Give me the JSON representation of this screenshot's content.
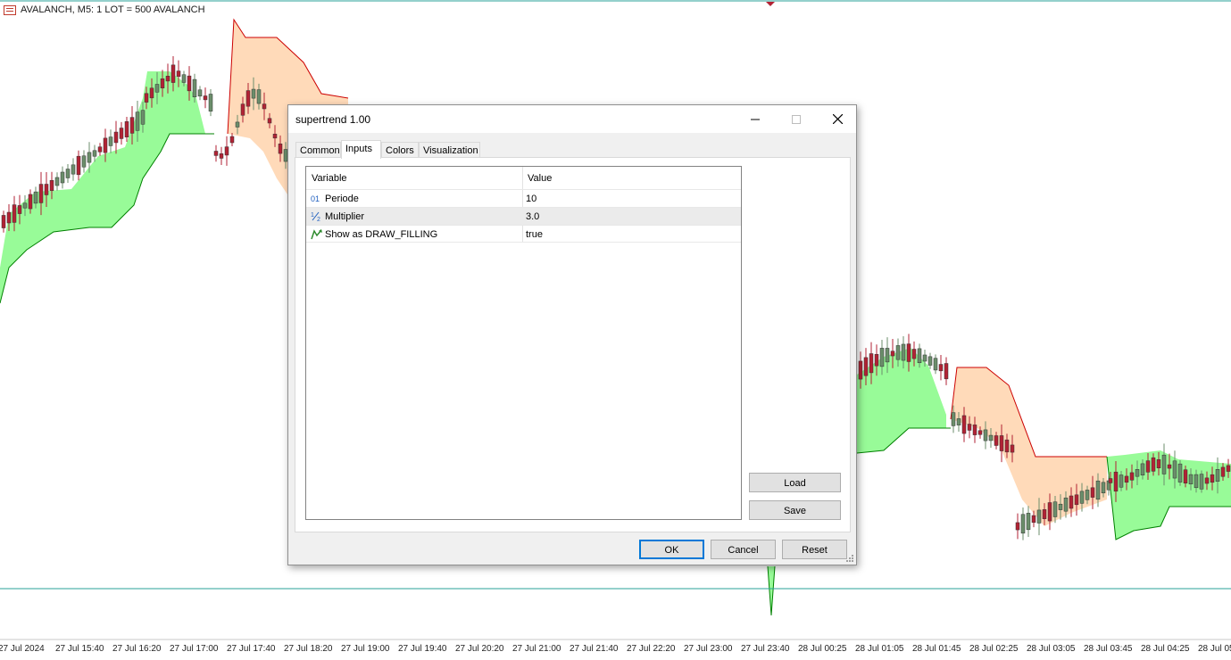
{
  "chart": {
    "title": "AVALANCH, M5:  1 LOT = 500 AVALANCH",
    "icon": "chart-window-icon",
    "time_labels": [
      "27 Jul 2024",
      "27 Jul 15:40",
      "27 Jul 16:20",
      "27 Jul 17:00",
      "27 Jul 17:40",
      "27 Jul 18:20",
      "27 Jul 19:00",
      "27 Jul 19:40",
      "27 Jul 20:20",
      "27 Jul 21:00",
      "27 Jul 21:40",
      "27 Jul 22:20",
      "27 Jul 23:00",
      "27 Jul 23:40",
      "28 Jul 00:25",
      "28 Jul 01:05",
      "28 Jul 01:45",
      "28 Jul 02:25",
      "28 Jul 03:05",
      "28 Jul 03:45",
      "28 Jul 04:25",
      "28 Jul 05"
    ],
    "colors": {
      "bull_fill": "#98fb98",
      "bear_fill": "#ffdab9",
      "bear_line": "#cc0000",
      "bull_line": "#008000",
      "candle_up": "#6b8e6b",
      "candle_down": "#b22234",
      "hline": "#2aa198"
    }
  },
  "dialog": {
    "title": "supertrend 1.00",
    "tabs": [
      "Common",
      "Inputs",
      "Colors",
      "Visualization"
    ],
    "active_tab": "Inputs",
    "table": {
      "headers": [
        "Variable",
        "Value"
      ],
      "rows": [
        {
          "icon": "integer-icon",
          "name": "Periode",
          "value": "10"
        },
        {
          "icon": "double-icon",
          "name": "Multiplier",
          "value": "3.0"
        },
        {
          "icon": "bool-icon",
          "name": "Show as DRAW_FILLING",
          "value": "true"
        }
      ]
    },
    "buttons": {
      "load": "Load",
      "save": "Save",
      "ok": "OK",
      "cancel": "Cancel",
      "reset": "Reset"
    }
  }
}
